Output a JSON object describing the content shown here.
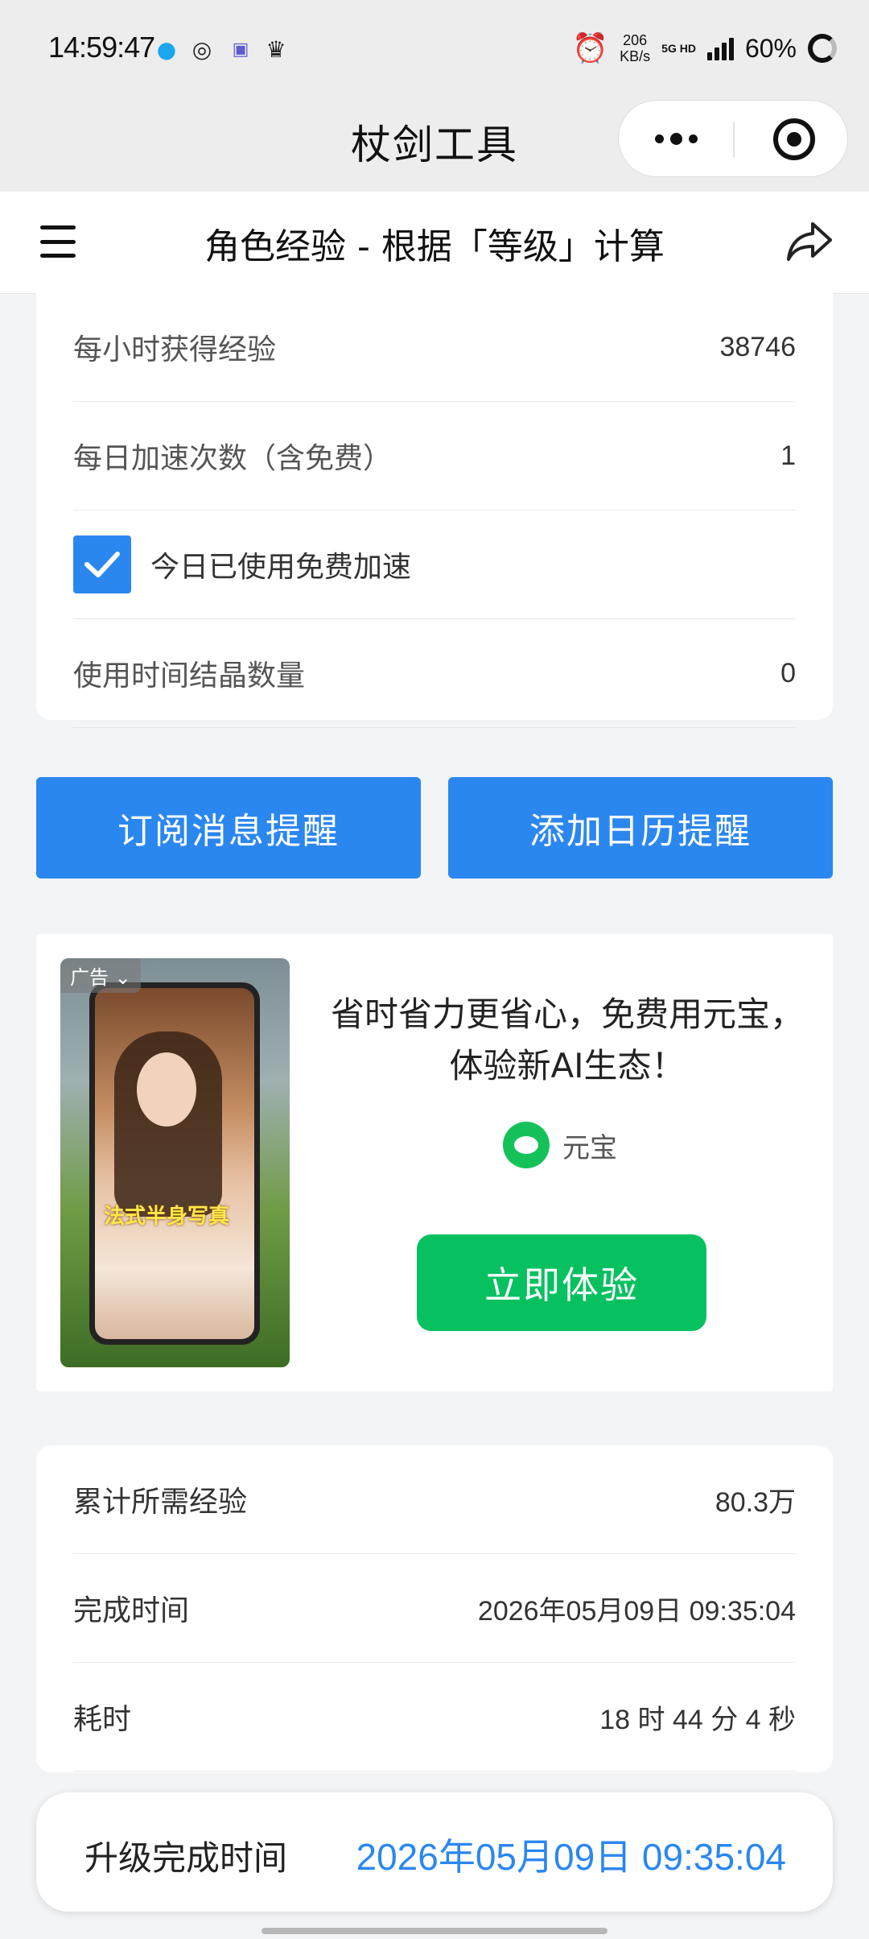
{
  "status_bar": {
    "time": "14:59:47",
    "speed_value": "206",
    "speed_unit": "KB/s",
    "network": "5G HD",
    "battery": "60%"
  },
  "mini_program": {
    "title": "杖剑工具"
  },
  "page": {
    "title": "角色经验 - 根据「等级」计算"
  },
  "params": [
    {
      "label": "每小时获得经验",
      "value": "38746"
    },
    {
      "label": "每日加速次数（含免费）",
      "value": "1"
    },
    {
      "label": "今日已使用免费加速",
      "checked": true
    },
    {
      "label": "使用时间结晶数量",
      "value": "0"
    }
  ],
  "buttons": {
    "subscribe": "订阅消息提醒",
    "calendar": "添加日历提醒"
  },
  "ad": {
    "tag": "广告",
    "image_caption": "法式半身写真",
    "text": "省时省力更省心，免费用元宝，体验新AI生态！",
    "brand": "元宝",
    "cta": "立即体验"
  },
  "results": [
    {
      "label": "累计所需经验",
      "value": "80.3万"
    },
    {
      "label": "完成时间",
      "value": "2026年05月09日 09:35:04"
    },
    {
      "label": "耗时",
      "value": "18 时 44 分 4 秒"
    }
  ],
  "bottom_bar": {
    "label": "升级完成时间",
    "value": "2026年05月09日 09:35:04"
  },
  "colors": {
    "primary_blue": "#2b87f0",
    "cta_green": "#07c160",
    "page_bg": "#f3f4f6"
  }
}
